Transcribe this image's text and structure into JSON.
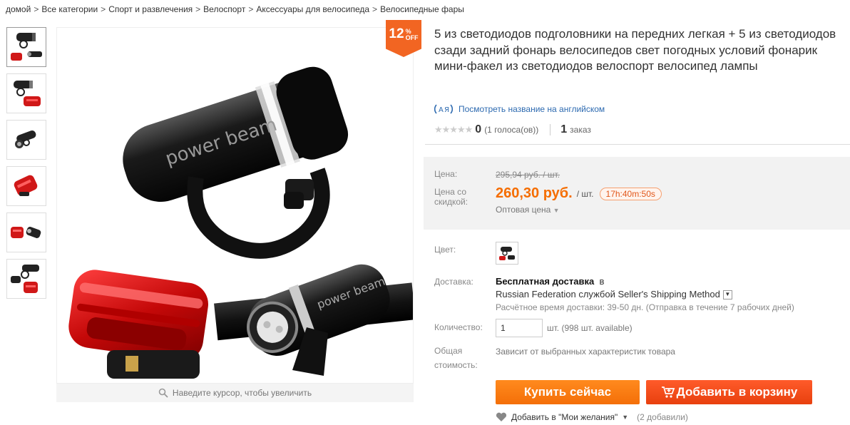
{
  "breadcrumb": [
    {
      "label": "домой"
    },
    {
      "label": "Все категории"
    },
    {
      "label": "Спорт и развлечения"
    },
    {
      "label": "Велоспорт"
    },
    {
      "label": "Аксессуары для велосипеда"
    },
    {
      "label": "Велосипедные фары"
    }
  ],
  "breadcrumb_separator": ">",
  "image_brand_text": "power beam",
  "zoom_hint": "Наведите курсор, чтобы увеличить",
  "discount": {
    "value": "12",
    "percent": "%",
    "off": "OFF"
  },
  "product": {
    "title": "5 из светодиодов подголовники на передних легкая + 5 из светодиодов сзади задний фонарь велосипедов свет погодных условий фонарик мини-факел из светодиодов велоспорт велосипед лампы",
    "translate_link": "Посмотреть название на английском",
    "rating_score": "0",
    "rating_votes": "(1 голоса(ов))",
    "orders_count": "1",
    "orders_label": "заказ"
  },
  "price": {
    "label_price": "Цена:",
    "old_price": "295,94 руб. / шт.",
    "label_discount_1": "Цена со",
    "label_discount_2": "скидкой:",
    "new_price": "260,30 руб.",
    "unit": "/ шт.",
    "timer": "17h:40m:50s",
    "wholesale": "Оптовая цена"
  },
  "color": {
    "label": "Цвет:"
  },
  "shipping": {
    "label": "Доставка:",
    "free": "Бесплатная доставка",
    "in": "в",
    "method": "Russian Federation службой Seller's Shipping Method",
    "eta": "Расчётное время доставки: 39-50 дн. (Отправка в течение 7 рабочих дней)"
  },
  "quantity": {
    "label": "Количество:",
    "value": "1",
    "available": "шт. (998 шт. available)"
  },
  "total": {
    "label_1": "Общая",
    "label_2": "стоимость:",
    "value": "Зависит от выбранных характеристик товара"
  },
  "buttons": {
    "buy": "Купить сейчас",
    "cart": "Добавить в корзину"
  },
  "wishlist": {
    "label": "Добавить в \"Мои желания\"",
    "count": "(2 добавили)"
  },
  "colors": {
    "accent": "#f56d00",
    "cart": "#e8400e",
    "link": "#2d6ab0"
  }
}
